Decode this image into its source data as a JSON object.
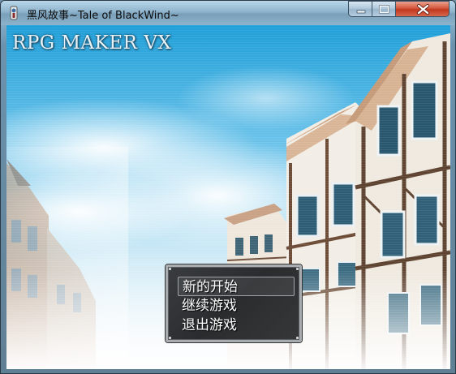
{
  "window": {
    "title": "黑风故事~Tale of BlackWind~"
  },
  "game": {
    "engine_logo": "RPG MAKER VX"
  },
  "title_menu": {
    "items": [
      {
        "label": "新的开始",
        "selected": true
      },
      {
        "label": "继续游戏",
        "selected": false
      },
      {
        "label": "退出游戏",
        "selected": false
      }
    ]
  },
  "icons": {
    "app": "rpg-maker-app-icon",
    "minimize": "minimize-icon",
    "maximize": "maximize-icon",
    "close": "close-icon"
  }
}
